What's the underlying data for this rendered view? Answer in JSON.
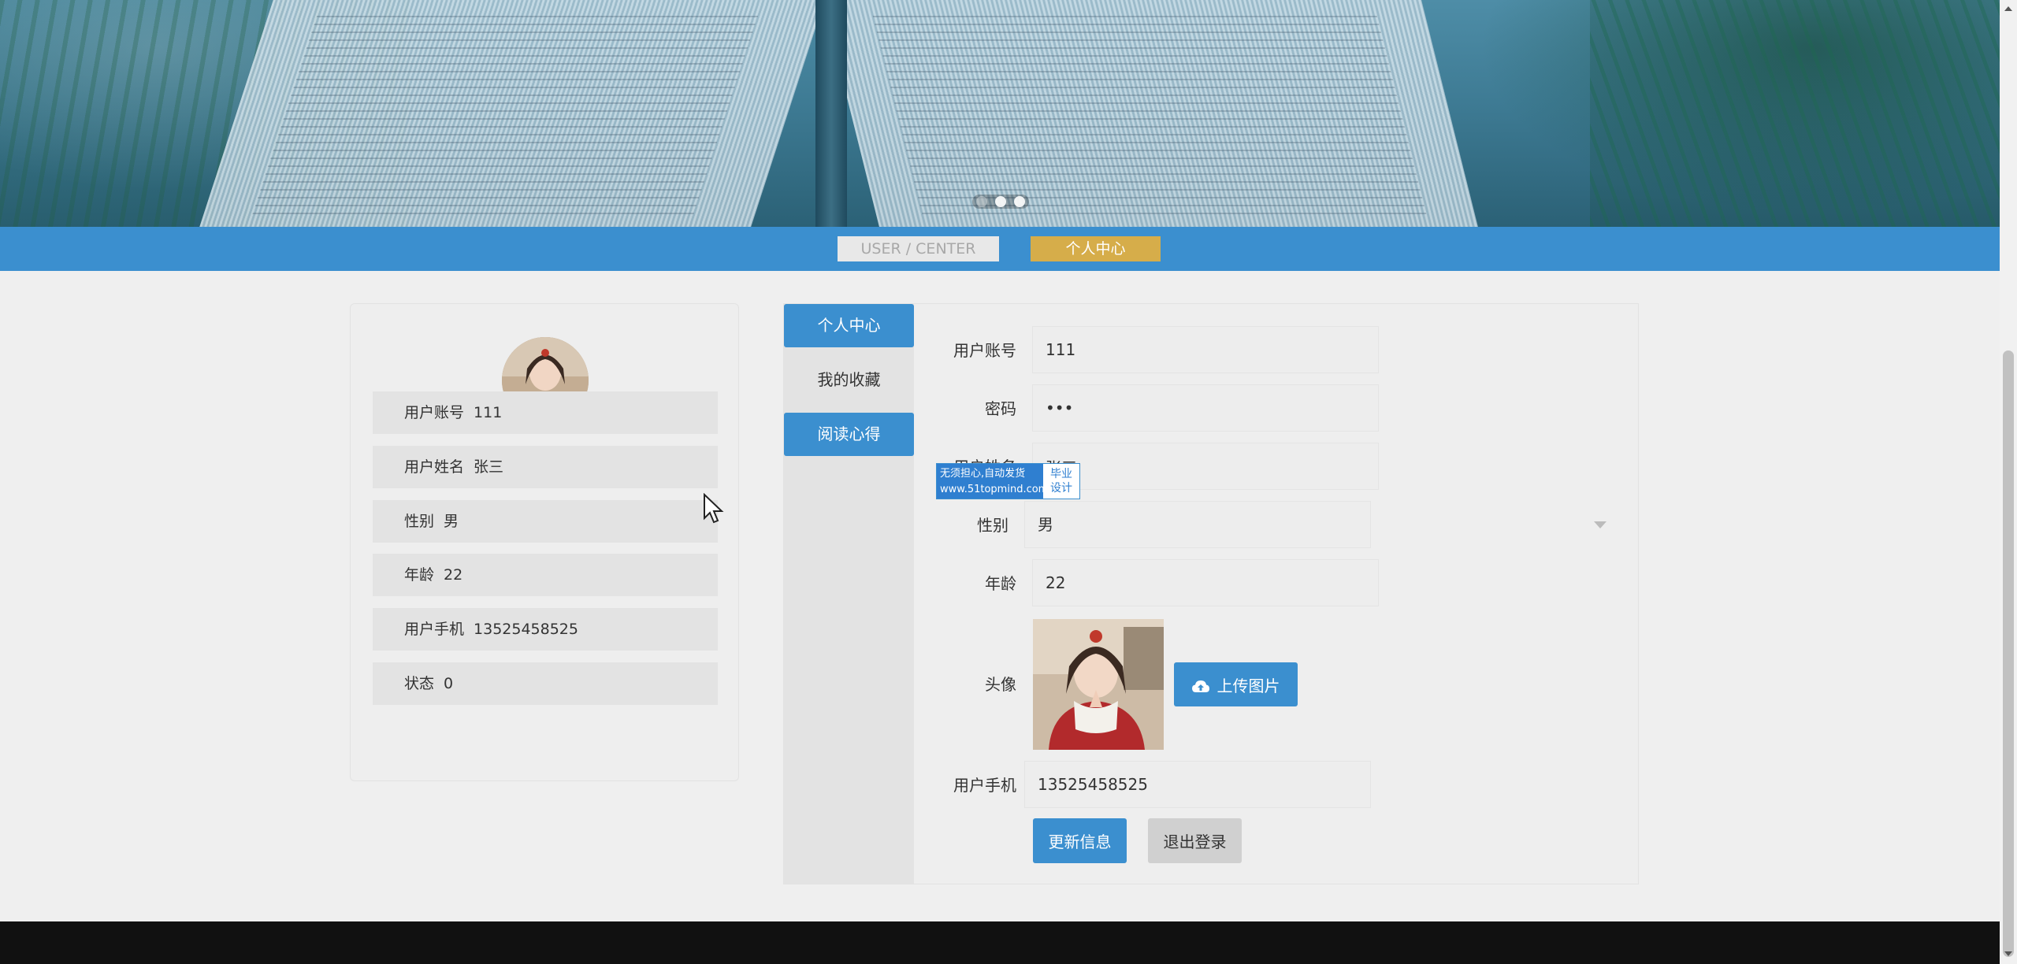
{
  "titlebar": {
    "en": "USER / CENTER",
    "cn": "个人中心"
  },
  "profile": {
    "rows": [
      {
        "label": "用户账号",
        "value": "111"
      },
      {
        "label": "用户姓名",
        "value": "张三"
      },
      {
        "label": "性别",
        "value": "男"
      },
      {
        "label": "年龄",
        "value": "22"
      },
      {
        "label": "用户手机",
        "value": "13525458525"
      },
      {
        "label": "状态",
        "value": "0"
      }
    ]
  },
  "menu": {
    "items": [
      {
        "label": "个人中心"
      },
      {
        "label": "我的收藏"
      },
      {
        "label": "阅读心得"
      }
    ]
  },
  "form": {
    "account_label": "用户账号",
    "account_value": "111",
    "password_label": "密码",
    "password_value": "•••",
    "name_label": "用户姓名",
    "name_value": "张三",
    "gender_label": "性别",
    "gender_value": "男",
    "age_label": "年龄",
    "age_value": "22",
    "avatar_label": "头像",
    "upload_label": "上传图片",
    "phone_label": "用户手机",
    "phone_value": "13525458525",
    "update_label": "更新信息",
    "logout_label": "退出登录"
  },
  "watermark": {
    "line1": "无须担心,自动发货",
    "line2": "www.51topmind.com",
    "right1": "毕业",
    "right2": "设计"
  },
  "carousel": {
    "active_index": 1,
    "count": 3
  }
}
